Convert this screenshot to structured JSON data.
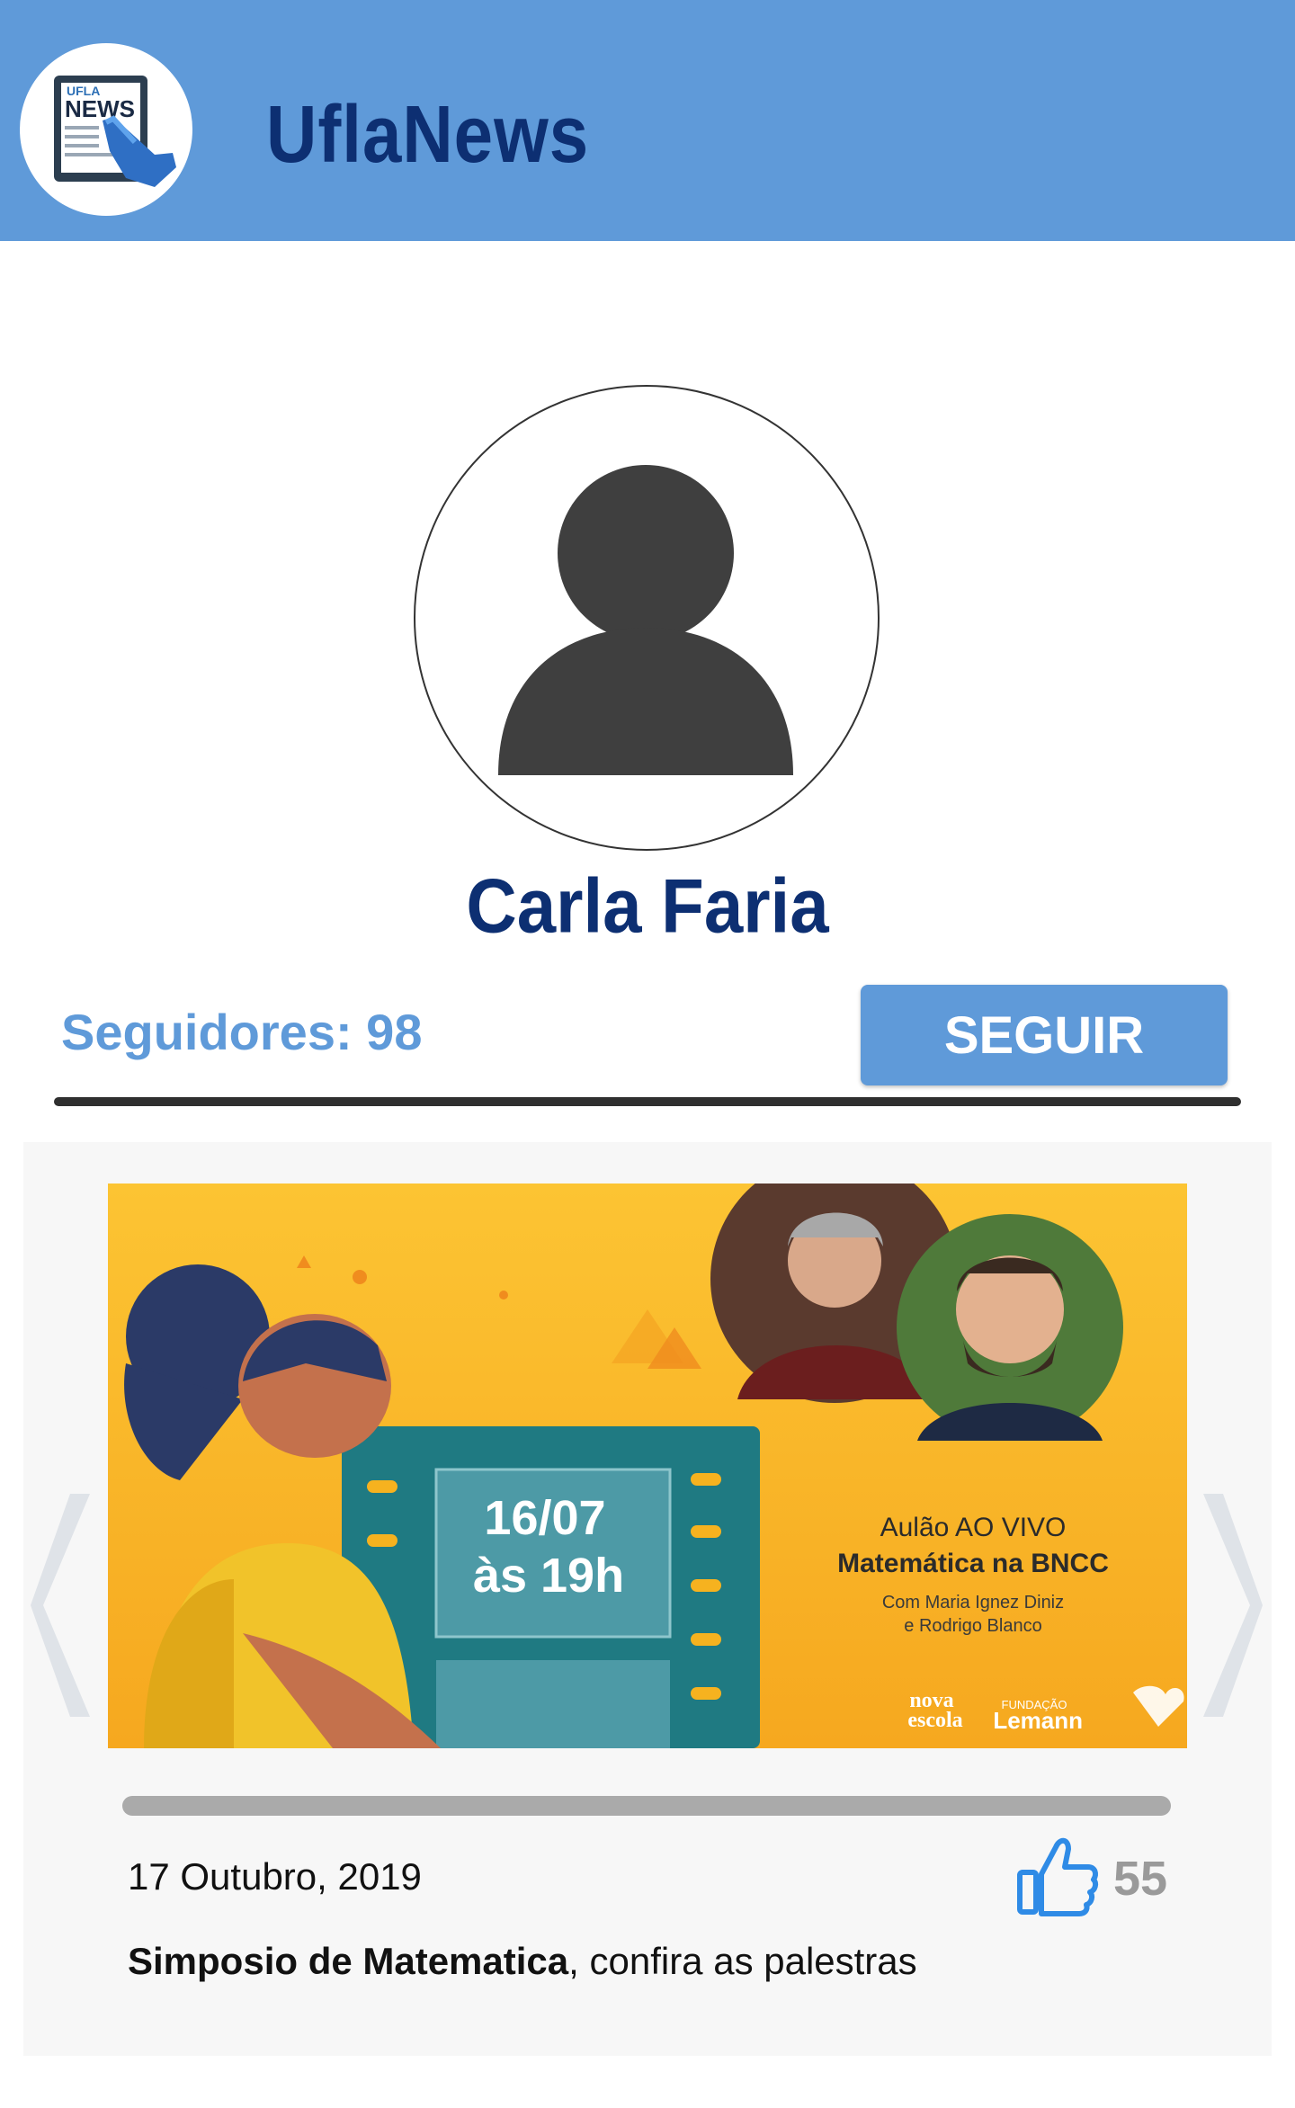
{
  "header": {
    "app_title": "UflaNews",
    "logo_text_top": "UFLA",
    "logo_text_main": "NEWS",
    "background_color": "#5f9ad9",
    "title_color": "#0d2f72"
  },
  "profile": {
    "name": "Carla Faria",
    "followers_label": "Seguidores: 98",
    "follow_button_label": "SEGUIR"
  },
  "post": {
    "banner": {
      "date_line": "16/07",
      "time_line": "às 19h",
      "headline_small": "Aulão AO VIVO",
      "headline_big": "Matemática na BNCC",
      "guests_line1": "Com Maria Ignez Diniz",
      "guests_line2": "e Rodrigo Blanco",
      "brand1_line1": "nova",
      "brand1_line2": "escola",
      "brand2_small": "FUNDAÇÃO",
      "brand2_big": "Lemann"
    },
    "date": "17 Outubro, 2019",
    "likes": "55",
    "caption_title": "Simposio de Matematica",
    "caption_rest": ", confira as palestras"
  },
  "icons": {
    "logo": "newspaper-hand-icon",
    "avatar": "user-silhouette-icon",
    "prev": "chevron-left-icon",
    "next": "chevron-right-icon",
    "like": "thumbs-up-icon"
  }
}
